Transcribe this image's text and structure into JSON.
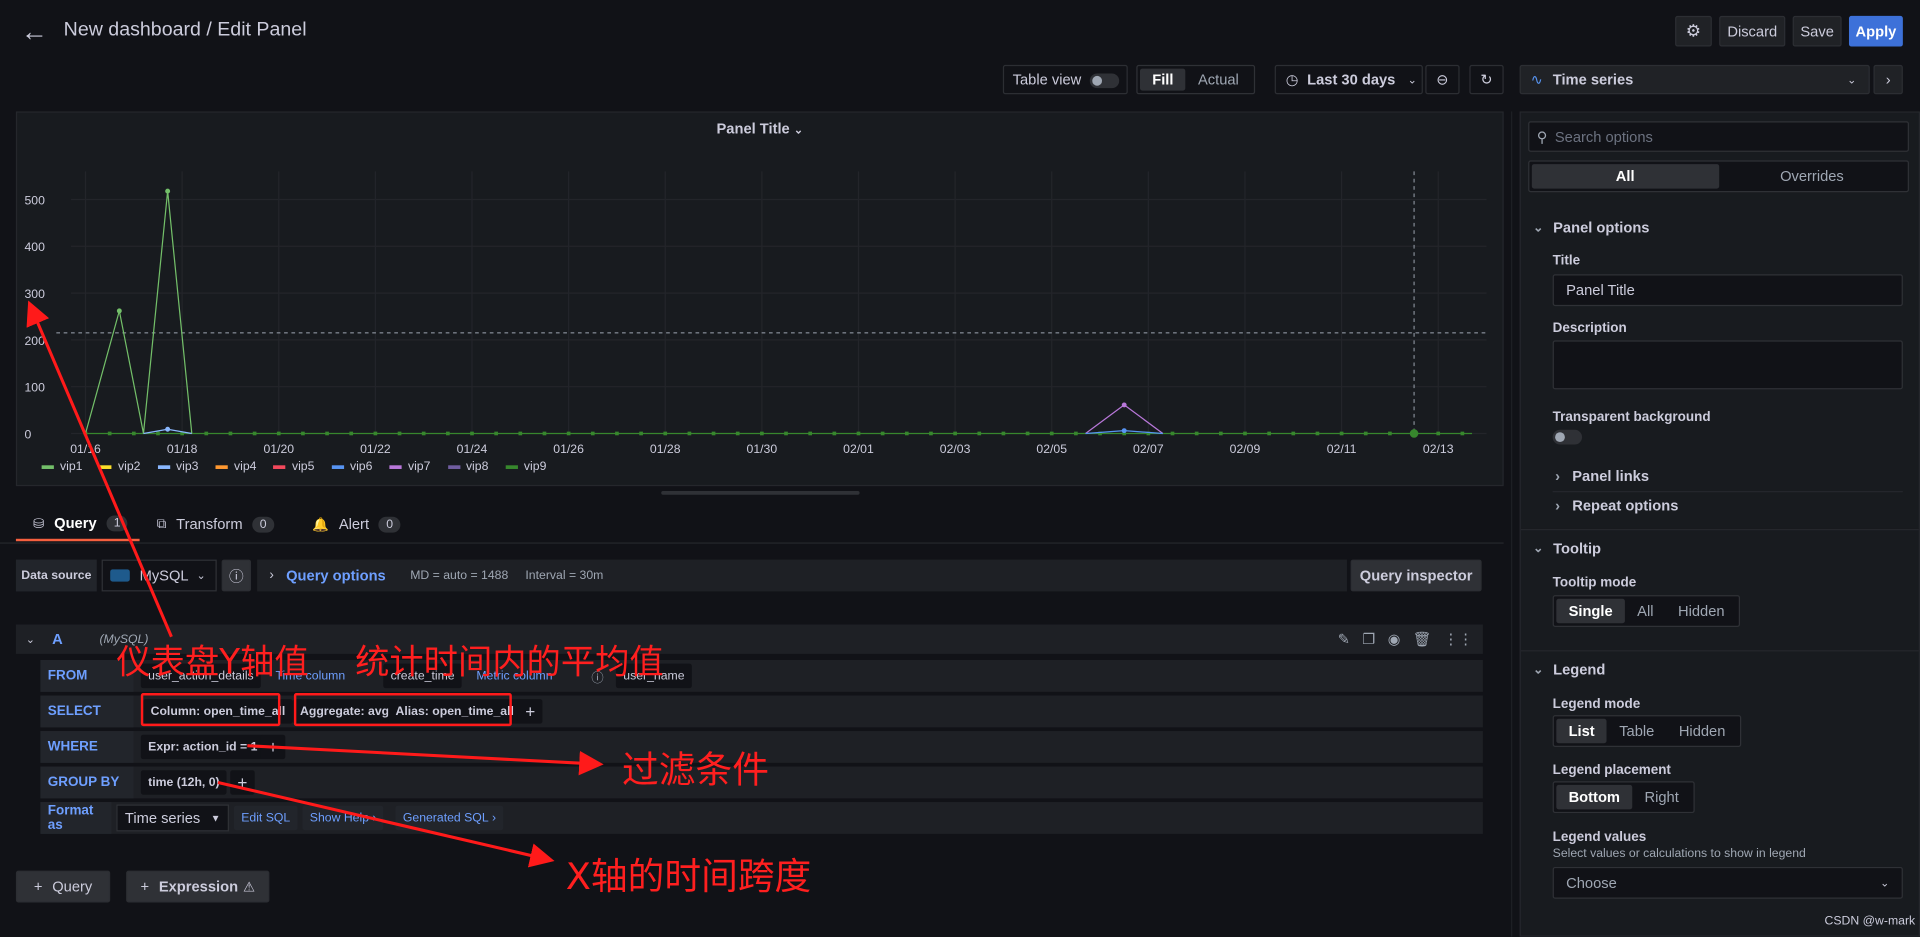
{
  "header": {
    "breadcrumb": "New dashboard / Edit Panel",
    "discard": "Discard",
    "save": "Save",
    "apply": "Apply"
  },
  "toolbar": {
    "table_view": "Table view",
    "fill": "Fill",
    "actual": "Actual",
    "time_range": "Last 30 days",
    "visualization": "Time series"
  },
  "panel": {
    "title": "Panel Title"
  },
  "chart_data": {
    "type": "line",
    "y_ticks": [
      "500",
      "400",
      "300",
      "200",
      "100",
      "0"
    ],
    "ylim": [
      0,
      560
    ],
    "x_ticks": [
      "01/16",
      "01/18",
      "01/20",
      "01/22",
      "01/24",
      "01/26",
      "01/28",
      "01/30",
      "02/01",
      "02/03",
      "02/05",
      "02/07",
      "02/09",
      "02/11",
      "02/13"
    ],
    "legend": [
      {
        "name": "vip1",
        "color": "#73bf69"
      },
      {
        "name": "vip2",
        "color": "#fade2a"
      },
      {
        "name": "vip3",
        "color": "#8ab8ff"
      },
      {
        "name": "vip4",
        "color": "#ff9830"
      },
      {
        "name": "vip5",
        "color": "#f2495c"
      },
      {
        "name": "vip6",
        "color": "#5794f2"
      },
      {
        "name": "vip7",
        "color": "#b877d9"
      },
      {
        "name": "vip8",
        "color": "#705da0"
      },
      {
        "name": "vip9",
        "color": "#37872d"
      }
    ],
    "series": [
      {
        "name": "vip1",
        "points": [
          [
            0.3,
            0
          ],
          [
            1.0,
            262
          ],
          [
            1.5,
            0
          ],
          [
            2.0,
            518
          ],
          [
            2.5,
            0
          ]
        ]
      },
      {
        "name": "vip3",
        "points": [
          [
            1.5,
            0
          ],
          [
            2.0,
            9
          ],
          [
            2.5,
            0
          ]
        ]
      },
      {
        "name": "vip7",
        "points": [
          [
            21.0,
            0
          ],
          [
            21.8,
            61
          ],
          [
            22.6,
            0
          ]
        ]
      },
      {
        "name": "vip6",
        "points": [
          [
            21.0,
            0
          ],
          [
            21.8,
            6
          ],
          [
            22.6,
            0
          ]
        ]
      }
    ],
    "baseline_series": "vip9"
  },
  "tabs": [
    {
      "label": "Query",
      "count": "1"
    },
    {
      "label": "Transform",
      "count": "0"
    },
    {
      "label": "Alert",
      "count": "0"
    }
  ],
  "datasource": {
    "label": "Data source",
    "value": "MySQL",
    "query_options": "Query options",
    "md": "MD = auto = 1488",
    "interval": "Interval = 30m",
    "inspector": "Query inspector"
  },
  "query": {
    "ref": "A",
    "ds": "(MySQL)",
    "from_kw": "FROM",
    "from_table": "user_action_details",
    "time_col_label": "Time column",
    "time_col": "create_time",
    "metric_col_label": "Metric column",
    "metric_col": "user_name",
    "select_kw": "SELECT",
    "column": "Column: open_time_all",
    "aggregate": "Aggregate: avg",
    "alias": "Alias: open_time_all",
    "where_kw": "WHERE",
    "expr": "Expr: action_id = 1",
    "groupby_kw": "GROUP BY",
    "groupby": "time (12h, 0)",
    "format_as": "Format as",
    "format_value": "Time series",
    "edit_sql": "Edit SQL",
    "show_help": "Show Help",
    "generated_sql": "Generated SQL"
  },
  "bottom_buttons": {
    "query": "Query",
    "expression": "Expression"
  },
  "options": {
    "search_placeholder": "Search options",
    "all": "All",
    "overrides": "Overrides",
    "panel_options": "Panel options",
    "title_label": "Title",
    "title_value": "Panel Title",
    "description_label": "Description",
    "transparent_label": "Transparent background",
    "panel_links": "Panel links",
    "repeat_options": "Repeat options",
    "tooltip": "Tooltip",
    "tooltip_mode": "Tooltip mode",
    "tooltip_modes": [
      "Single",
      "All",
      "Hidden"
    ],
    "legend": "Legend",
    "legend_mode": "Legend mode",
    "legend_modes": [
      "List",
      "Table",
      "Hidden"
    ],
    "legend_placement": "Legend placement",
    "legend_placements": [
      "Bottom",
      "Right"
    ],
    "legend_values": "Legend values",
    "legend_values_desc": "Select values or calculations to show in legend",
    "choose": "Choose"
  },
  "annotations": {
    "y_axis": "仪表盘Y轴值",
    "avg": "统计时间内的平均值",
    "filter": "过滤条件",
    "x_span": "X轴的时间跨度"
  },
  "watermark": "CSDN @w-mark",
  "colors": {
    "accent": "#3d71d9",
    "annotation": "#ff1f1f",
    "tab_active": "#f55f3e"
  }
}
